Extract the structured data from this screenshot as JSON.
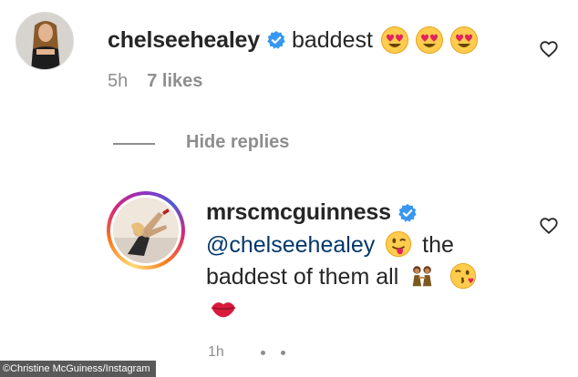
{
  "comment": {
    "username": "chelseehealey",
    "text": "baddest",
    "emojis": [
      "heart-eyes-emoji",
      "heart-eyes-emoji",
      "heart-eyes-emoji"
    ],
    "time": "5h",
    "likes": "7 likes"
  },
  "hide_replies": "Hide replies",
  "reply": {
    "username": "mrscmcguinness",
    "mention": "@chelseehealey",
    "text_part1": "the",
    "text_part2": "baddest of them all",
    "emojis": [
      "winking-tongue-emoji",
      "two-women-emoji",
      "kiss-wink-emoji",
      "lips-emoji"
    ],
    "meta_partial": "1h"
  },
  "credit": "©Christine McGuiness/Instagram",
  "colors": {
    "text": "#262626",
    "muted": "#8e8e8e",
    "verified": "#3897f0",
    "mention": "#00376b"
  },
  "icons": [
    "verified-badge-icon",
    "heart-outline-icon"
  ]
}
